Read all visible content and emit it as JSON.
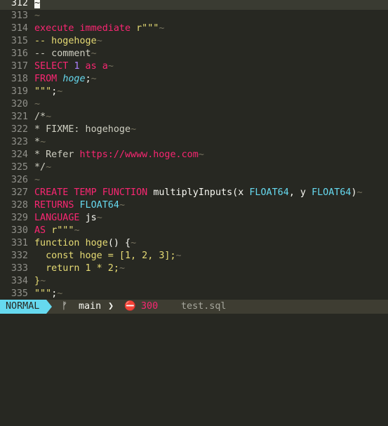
{
  "colors": {
    "background": "#272822",
    "keyword": "#f92672",
    "constant": "#ae81ff",
    "type": "#66d9ef",
    "string": "#e6db74",
    "plain": "#f8f8f2",
    "comment_text": "#cfcfc2",
    "whitespace": "#75715e",
    "line_number": "#90908a",
    "statusbar": "#3e3d32",
    "mode_bg": "#66d9ef"
  },
  "lines": [
    {
      "num": "312",
      "current": true,
      "segs": [
        {
          "t": "~",
          "c": "cursor"
        }
      ]
    },
    {
      "num": "313",
      "segs": [
        {
          "t": "~",
          "c": "whitespace"
        }
      ]
    },
    {
      "num": "314",
      "segs": [
        {
          "t": "execute immediate ",
          "c": "keyword"
        },
        {
          "t": "r\"\"\"",
          "c": "string"
        },
        {
          "t": "~",
          "c": "whitespace"
        }
      ]
    },
    {
      "num": "315",
      "segs": [
        {
          "t": "-- hogehoge",
          "c": "string"
        },
        {
          "t": "~",
          "c": "whitespace"
        }
      ]
    },
    {
      "num": "316",
      "segs": [
        {
          "t": "-- comment",
          "c": "comment_text"
        },
        {
          "t": "~",
          "c": "whitespace"
        }
      ]
    },
    {
      "num": "317",
      "segs": [
        {
          "t": "SELECT ",
          "c": "keyword"
        },
        {
          "t": "1",
          "c": "constant"
        },
        {
          "t": " as ",
          "c": "keyword"
        },
        {
          "t": "a",
          "c": "keyword"
        },
        {
          "t": "~",
          "c": "whitespace"
        }
      ]
    },
    {
      "num": "318",
      "segs": [
        {
          "t": "FROM ",
          "c": "keyword"
        },
        {
          "t": "hoge",
          "c": "type",
          "italic": true
        },
        {
          "t": ";",
          "c": "plain"
        },
        {
          "t": "~",
          "c": "whitespace"
        }
      ]
    },
    {
      "num": "319",
      "segs": [
        {
          "t": "\"\"\"",
          "c": "string"
        },
        {
          "t": ";",
          "c": "plain"
        },
        {
          "t": "~",
          "c": "whitespace"
        }
      ]
    },
    {
      "num": "320",
      "segs": [
        {
          "t": "~",
          "c": "whitespace"
        }
      ]
    },
    {
      "num": "321",
      "segs": [
        {
          "t": "/*",
          "c": "comment_text"
        },
        {
          "t": "~",
          "c": "whitespace"
        }
      ]
    },
    {
      "num": "322",
      "segs": [
        {
          "t": "* FIXME: hogehoge",
          "c": "comment_text"
        },
        {
          "t": "~",
          "c": "whitespace"
        }
      ]
    },
    {
      "num": "323",
      "segs": [
        {
          "t": "*",
          "c": "comment_text"
        },
        {
          "t": "~",
          "c": "whitespace"
        }
      ]
    },
    {
      "num": "324",
      "segs": [
        {
          "t": "* Refer ",
          "c": "comment_text"
        },
        {
          "t": "https://wwww.hoge.com",
          "c": "keyword"
        },
        {
          "t": "~",
          "c": "whitespace"
        }
      ]
    },
    {
      "num": "325",
      "segs": [
        {
          "t": "*/",
          "c": "comment_text"
        },
        {
          "t": "~",
          "c": "whitespace"
        }
      ]
    },
    {
      "num": "326",
      "segs": [
        {
          "t": "~",
          "c": "whitespace"
        }
      ]
    },
    {
      "num": "327",
      "segs": [
        {
          "t": "CREATE TEMP FUNCTION ",
          "c": "keyword"
        },
        {
          "t": "multiplyInputs(x ",
          "c": "plain"
        },
        {
          "t": "FLOAT64",
          "c": "type"
        },
        {
          "t": ", y ",
          "c": "plain"
        },
        {
          "t": "FLOAT64",
          "c": "type"
        },
        {
          "t": ")",
          "c": "plain"
        },
        {
          "t": "~",
          "c": "whitespace"
        }
      ]
    },
    {
      "num": "328",
      "segs": [
        {
          "t": "RETURNS ",
          "c": "keyword"
        },
        {
          "t": "FLOAT64",
          "c": "type"
        },
        {
          "t": "~",
          "c": "whitespace"
        }
      ]
    },
    {
      "num": "329",
      "segs": [
        {
          "t": "LANGUAGE ",
          "c": "keyword"
        },
        {
          "t": "js",
          "c": "plain"
        },
        {
          "t": "~",
          "c": "whitespace"
        }
      ]
    },
    {
      "num": "330",
      "segs": [
        {
          "t": "AS ",
          "c": "keyword"
        },
        {
          "t": "r\"\"\"",
          "c": "string"
        },
        {
          "t": "~",
          "c": "whitespace"
        }
      ]
    },
    {
      "num": "331",
      "segs": [
        {
          "t": "function ",
          "c": "string"
        },
        {
          "t": "hoge",
          "c": "string"
        },
        {
          "t": "() {",
          "c": "plain"
        },
        {
          "t": "~",
          "c": "whitespace"
        }
      ]
    },
    {
      "num": "332",
      "segs": [
        {
          "t": "  const hoge = [1, 2, 3];",
          "c": "string"
        },
        {
          "t": "~",
          "c": "whitespace"
        }
      ]
    },
    {
      "num": "333",
      "segs": [
        {
          "t": "  return 1 * 2;",
          "c": "string"
        },
        {
          "t": "~",
          "c": "whitespace"
        }
      ]
    },
    {
      "num": "334",
      "segs": [
        {
          "t": "}",
          "c": "string"
        },
        {
          "t": "~",
          "c": "whitespace"
        }
      ]
    },
    {
      "num": "335",
      "segs": [
        {
          "t": "\"\"\"",
          "c": "string"
        },
        {
          "t": ";",
          "c": "plain"
        },
        {
          "t": "~",
          "c": "whitespace"
        }
      ]
    }
  ],
  "statusbar": {
    "mode": "NORMAL",
    "branch_icon": "ᚠ",
    "branch": "main",
    "separator": "❯",
    "diagnostics_icon": "⛔",
    "diagnostics_count": "300",
    "filename": "test.sql"
  }
}
